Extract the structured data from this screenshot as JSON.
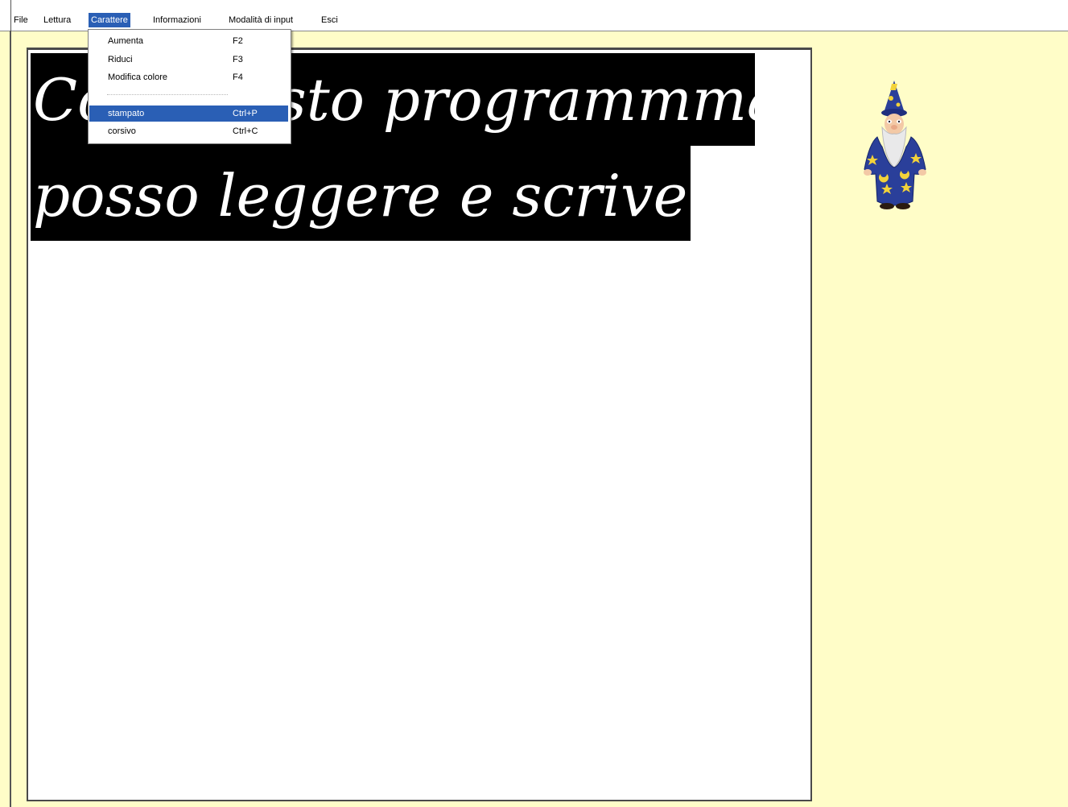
{
  "menubar": {
    "items": [
      {
        "label": "File"
      },
      {
        "label": "Lettura"
      },
      {
        "label": "Carattere",
        "active": true
      },
      {
        "label": "Informazioni"
      },
      {
        "label": "Modalità di input"
      },
      {
        "label": "Esci"
      }
    ]
  },
  "dropdown": {
    "items": [
      {
        "label": "Aumenta",
        "shortcut": "F2"
      },
      {
        "label": "Riduci",
        "shortcut": "F3"
      },
      {
        "label": "Modifica colore",
        "shortcut": "F4"
      },
      {
        "label": "stampato",
        "shortcut": "Ctrl+P",
        "selected": true
      },
      {
        "label": "corsivo",
        "shortcut": "Ctrl+C"
      }
    ]
  },
  "document": {
    "line1": "Con questo programmma",
    "line2": "posso leggere e scrivere."
  },
  "colors": {
    "background": "#fffdc8",
    "highlight": "#2a5fb5",
    "text_bg": "#000000",
    "text_fg": "#ffffff"
  },
  "assistant": {
    "icon": "wizard-icon"
  }
}
